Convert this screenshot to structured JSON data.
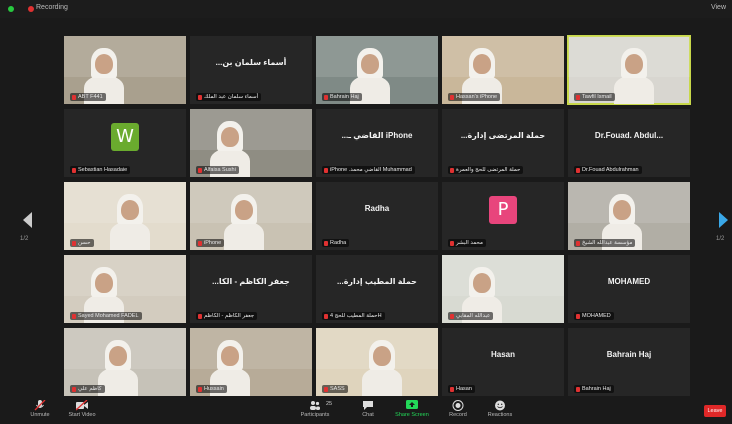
{
  "topbar": {
    "recording_label": "Recording",
    "view_label": "View"
  },
  "tiles": [
    {
      "name": "ABT F441",
      "display": ""
    },
    {
      "name": "أسماء سلمان عبد الملك",
      "display": "...أسماء سلمان بن"
    },
    {
      "name": "Bahrain Haj",
      "display": ""
    },
    {
      "name": "Hassan's iPhone",
      "display": ""
    },
    {
      "name": "Tawfil Ismail",
      "display": ""
    },
    {
      "name": "Sebastian Hasadaie",
      "display": ""
    },
    {
      "name": "Alfaisa Sushi",
      "display": ""
    },
    {
      "name": "iPhone .القاضي محمد Muhammad",
      "display": "...القاضي ـ iPhone"
    },
    {
      "name": "حملة المرتضى للحج والعمرة",
      "display": "...حملة المرتضى إدارة"
    },
    {
      "name": "Dr.Fouad Abdulrahman",
      "display": "Dr.Fouad. Abdul..."
    },
    {
      "name": "حسن",
      "display": ""
    },
    {
      "name": "iPhone",
      "display": ""
    },
    {
      "name": "Radha",
      "display": "Radha"
    },
    {
      "name": "محمد البشر",
      "display": ""
    },
    {
      "name": "مؤسسة عبدالله الشيخ",
      "display": ""
    },
    {
      "name": "Sayed Mohamed FADEL",
      "display": ""
    },
    {
      "name": "جعفر الكاظم - الكاظم",
      "display": "...جعفر الكاظم - الكا"
    },
    {
      "name": "حملة المطيب للحج 4H",
      "display": "...حملة المطيب إدارة"
    },
    {
      "name": "عبدالله المقابي",
      "display": ""
    },
    {
      "name": "MOHAMED",
      "display": "MOHAMED"
    },
    {
      "name": "كاظم علي",
      "display": ""
    },
    {
      "name": "Hussain",
      "display": ""
    },
    {
      "name": "SASS",
      "display": ""
    },
    {
      "name": "Hasan",
      "display": "Hasan"
    },
    {
      "name": "Bahrain Haj",
      "display": "Bahrain Haj"
    }
  ],
  "tile_styles": [
    {
      "kind": "video",
      "bg": "#a9a08e"
    },
    {
      "kind": "name",
      "bg": "#262626"
    },
    {
      "kind": "video",
      "bg": "#7f8a86"
    },
    {
      "kind": "video",
      "bg": "#c9b79a"
    },
    {
      "kind": "video",
      "bg": "#d8d6d0"
    },
    {
      "kind": "avatar",
      "bg": "#262626",
      "avatar_letter": "W",
      "avatar_color": "#6aab2e"
    },
    {
      "kind": "video",
      "bg": "#8f8d83"
    },
    {
      "kind": "name",
      "bg": "#262626"
    },
    {
      "kind": "name",
      "bg": "#262626"
    },
    {
      "kind": "name",
      "bg": "#262626"
    },
    {
      "kind": "video",
      "bg": "#e3dccd"
    },
    {
      "kind": "video",
      "bg": "#c9c2b3"
    },
    {
      "kind": "name",
      "bg": "#262626"
    },
    {
      "kind": "avatar",
      "bg": "#262626",
      "avatar_letter": "P",
      "avatar_color": "#e8457c"
    },
    {
      "kind": "video",
      "bg": "#b1aea5"
    },
    {
      "kind": "video",
      "bg": "#d3ccbf"
    },
    {
      "kind": "name",
      "bg": "#262626"
    },
    {
      "kind": "name",
      "bg": "#262626"
    },
    {
      "kind": "video",
      "bg": "#d8dad2"
    },
    {
      "kind": "name",
      "bg": "#262626"
    },
    {
      "kind": "video",
      "bg": "#c6c2b8"
    },
    {
      "kind": "video",
      "bg": "#b7ab98"
    },
    {
      "kind": "video",
      "bg": "#dfd4bd"
    },
    {
      "kind": "name",
      "bg": "#262626"
    },
    {
      "kind": "name",
      "bg": "#262626"
    }
  ],
  "active_speaker_index": 4,
  "nav": {
    "left_page": "1/2",
    "right_page": "1/2"
  },
  "toolbar": {
    "unmute": "Unmute",
    "start_video": "Start Video",
    "participants": "Participants",
    "participants_count": "25",
    "chat": "Chat",
    "share_screen": "Share Screen",
    "record": "Record",
    "reactions": "Reactions",
    "end": "Leave"
  },
  "colors": {
    "accent_green": "#23d959",
    "active_outline": "#c8d84a",
    "end_red": "#e02828"
  }
}
